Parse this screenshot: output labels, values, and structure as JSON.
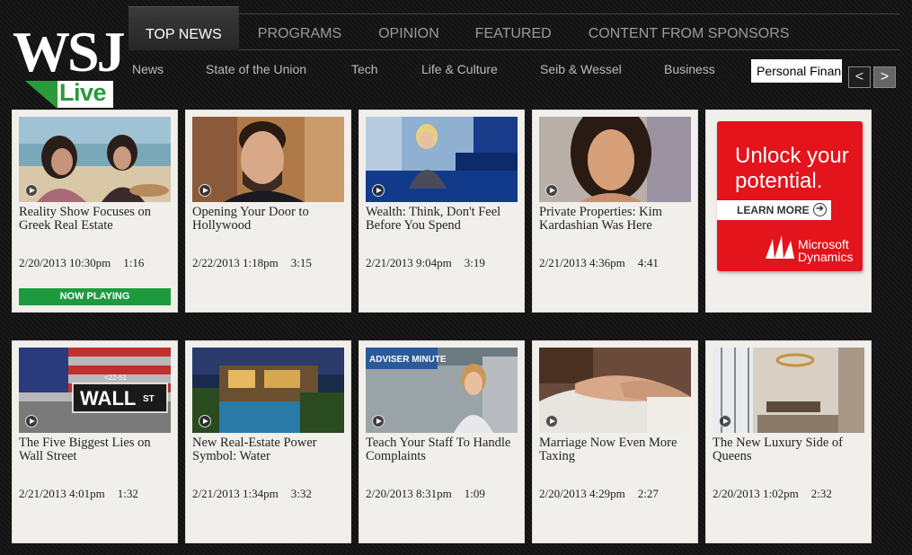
{
  "logo": {
    "main": "WSJ",
    "sub": "Live"
  },
  "main_nav": [
    "TOP NEWS",
    "PROGRAMS",
    "OPINION",
    "FEATURED",
    "CONTENT FROM SPONSORS"
  ],
  "sub_nav": [
    "News",
    "State of the Union",
    "Tech",
    "Life & Culture",
    "Seib & Wessel",
    "Business"
  ],
  "sub_nav_selected": "Personal Finan",
  "arrows": {
    "prev": "<",
    "next": ">"
  },
  "now_playing_label": "NOW PLAYING",
  "videos": [
    {
      "title": "Reality Show Focuses on Greek Real Estate",
      "date": "2/20/2013 10:30pm",
      "duration": "1:16"
    },
    {
      "title": "Opening Your Door to Hollywood",
      "date": "2/22/2013 1:18pm",
      "duration": "3:15"
    },
    {
      "title": "Wealth: Think, Don't Feel Before You Spend",
      "date": "2/21/2013 9:04pm",
      "duration": "3:19"
    },
    {
      "title": "Private Properties: Kim Kardashian Was Here",
      "date": "2/21/2013 4:36pm",
      "duration": "4:41"
    },
    {
      "title": "The Five Biggest Lies on Wall Street",
      "date": "2/21/2013 4:01pm",
      "duration": "1:32"
    },
    {
      "title": "New Real-Estate Power Symbol: Water",
      "date": "2/21/2013 1:34pm",
      "duration": "3:32"
    },
    {
      "title": "Teach Your Staff To Handle Complaints",
      "date": "2/20/2013 8:31pm",
      "duration": "1:09"
    },
    {
      "title": "Marriage Now Even More Taxing",
      "date": "2/20/2013 4:29pm",
      "duration": "2:27"
    },
    {
      "title": "The New Luxury Side of Queens",
      "date": "2/20/2013 1:02pm",
      "duration": "2:32"
    }
  ],
  "ad": {
    "headline": "Unlock your potential.",
    "cta": "LEARN MORE",
    "brand_line1": "Microsoft",
    "brand_line2": "Dynamics"
  },
  "thumb_text": {
    "wall_sign": "WALL",
    "wall_st": "ST",
    "wall_num": "<22-51",
    "adviser": "ADVISER MINUTE"
  }
}
